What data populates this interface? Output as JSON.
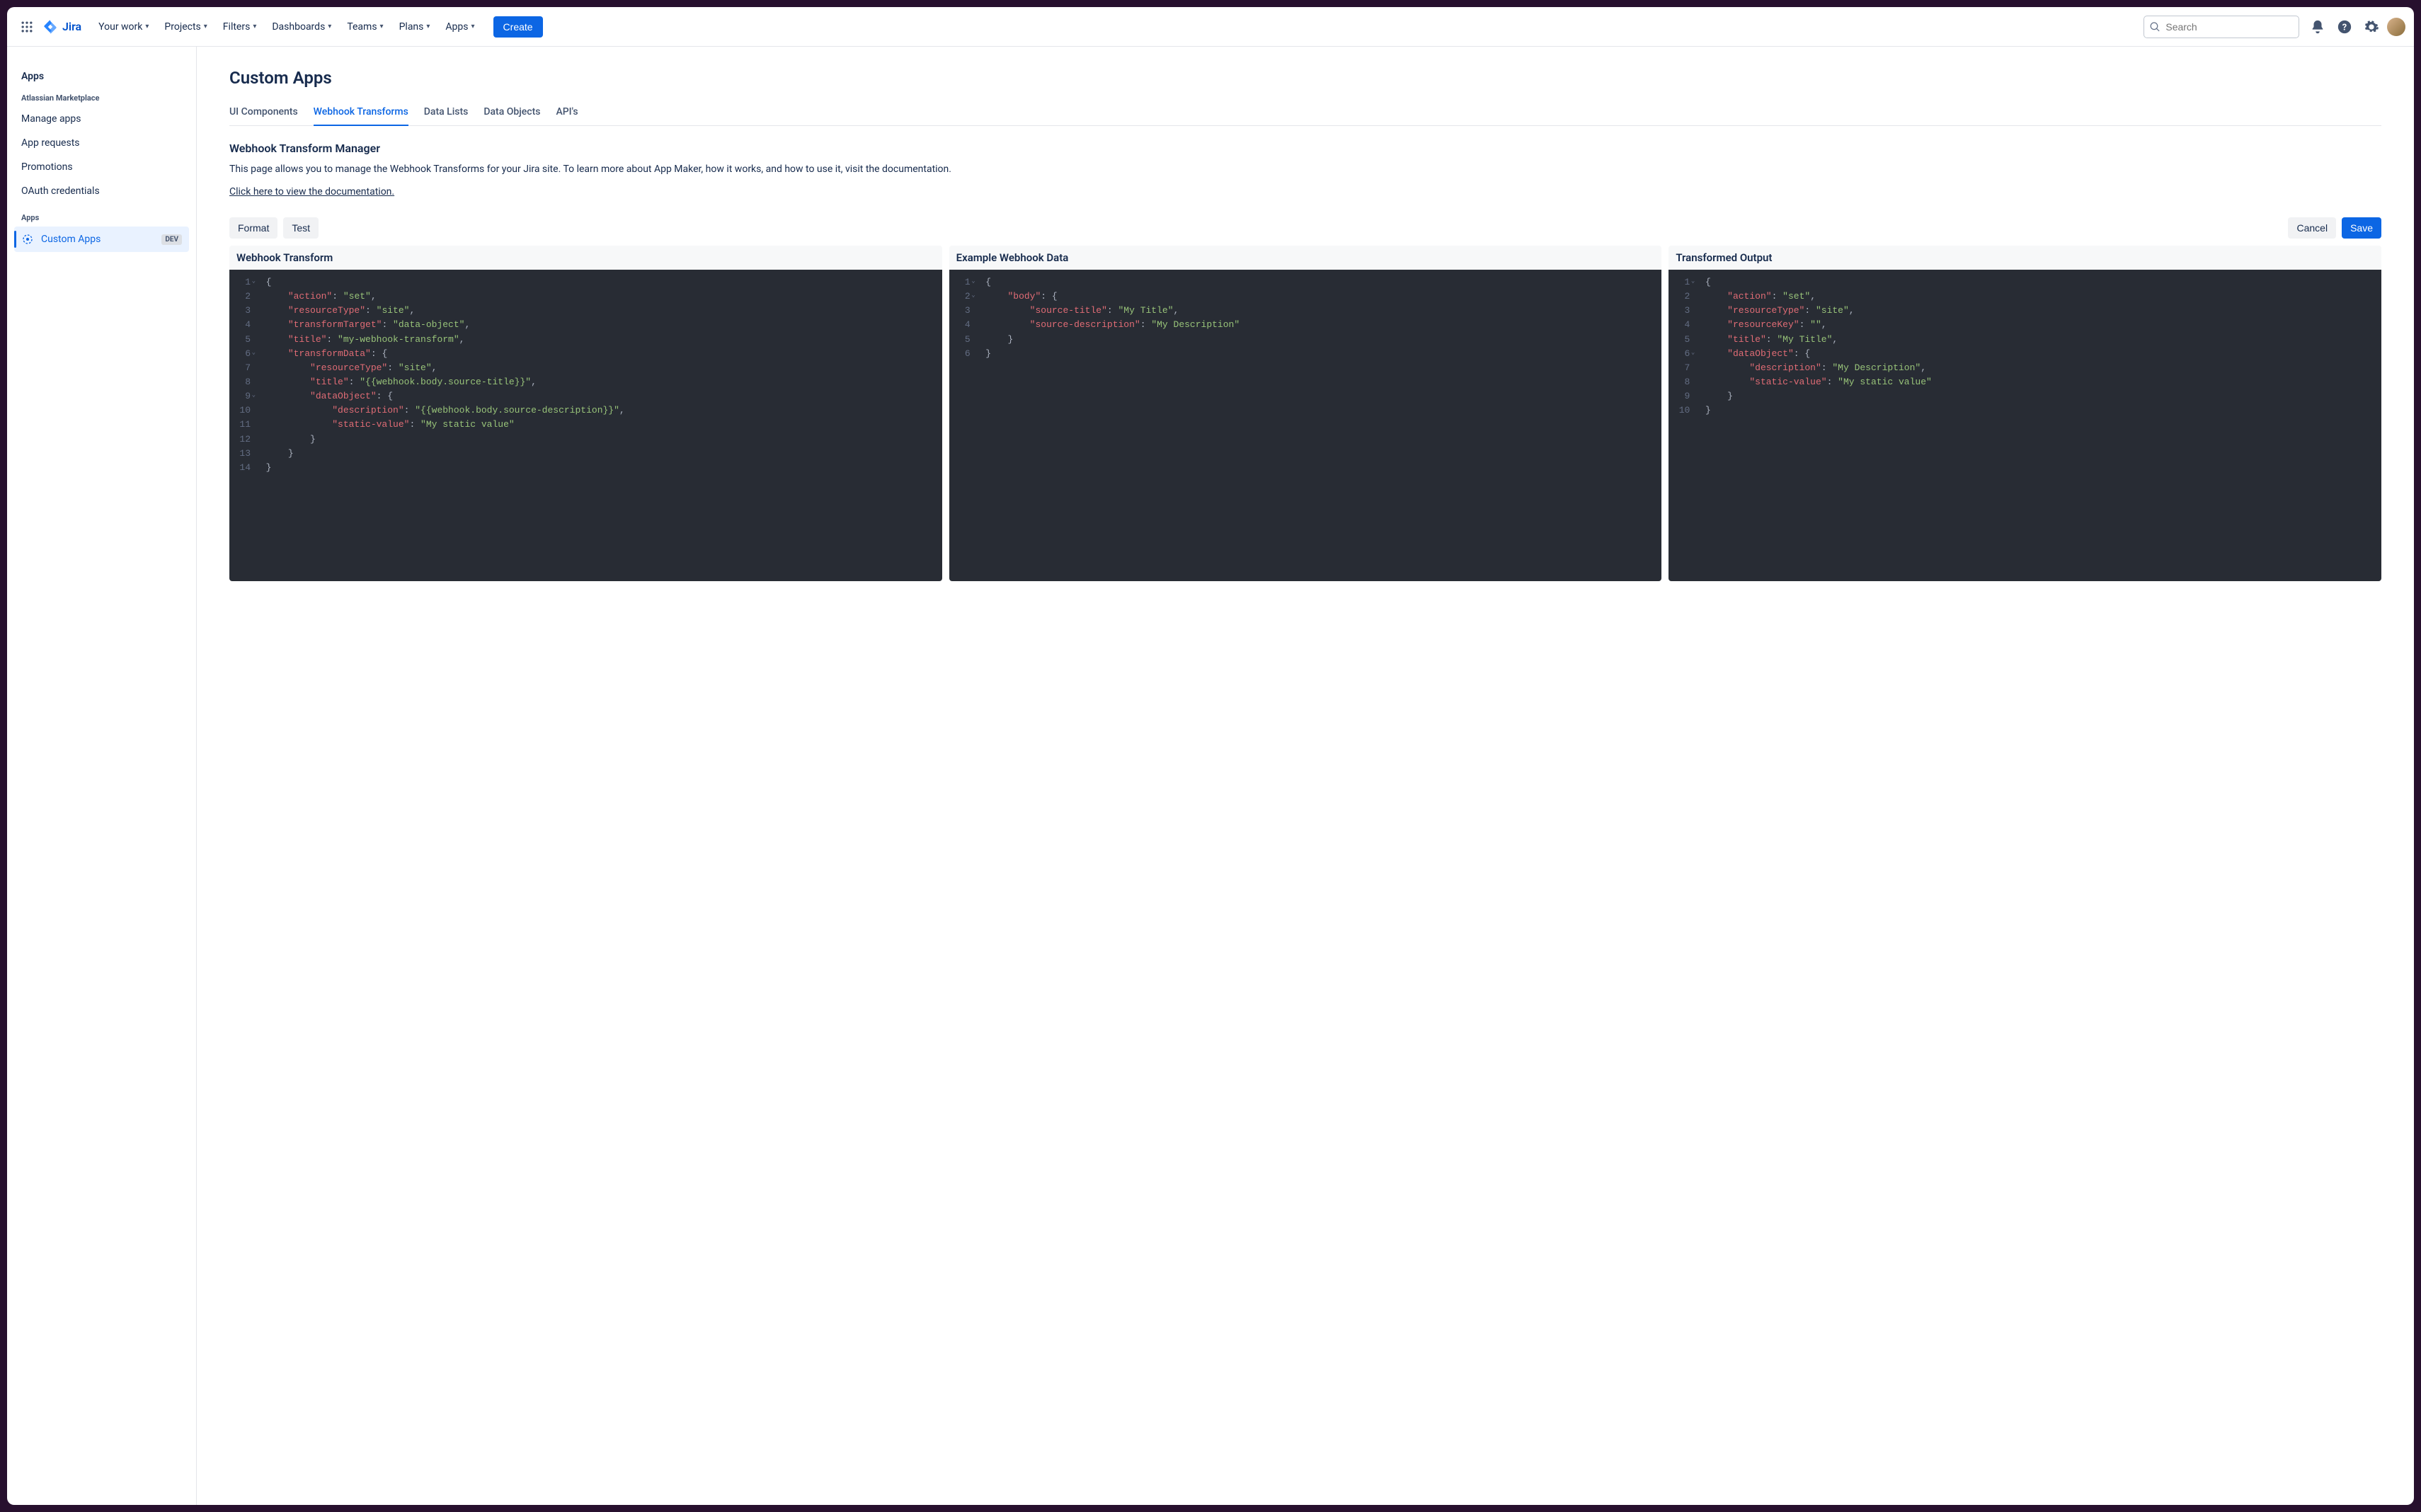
{
  "nav": {
    "product": "Jira",
    "items": [
      "Your work",
      "Projects",
      "Filters",
      "Dashboards",
      "Teams",
      "Plans",
      "Apps"
    ],
    "create": "Create",
    "search_placeholder": "Search"
  },
  "sidebar": {
    "title": "Apps",
    "section1": {
      "label": "Atlassian Marketplace",
      "items": [
        "Manage apps",
        "App requests",
        "Promotions",
        "OAuth credentials"
      ]
    },
    "section2": {
      "label": "Apps",
      "active_item": "Custom Apps",
      "badge": "DEV"
    }
  },
  "page": {
    "title": "Custom Apps",
    "tabs": [
      "UI Components",
      "Webhook Transforms",
      "Data Lists",
      "Data Objects",
      "API's"
    ],
    "active_tab_index": 1,
    "section_title": "Webhook Transform Manager",
    "description": "This page allows you to manage the Webhook Transforms for your Jira site. To learn more about App Maker, how it works, and how to use it, visit the documentation.",
    "doc_link": "Click here to view the documentation."
  },
  "toolbar": {
    "format": "Format",
    "test": "Test",
    "cancel": "Cancel",
    "save": "Save"
  },
  "editors": {
    "col1": {
      "title": "Webhook Transform",
      "lines": [
        {
          "n": 1,
          "fold": true,
          "indent": 0,
          "tokens": [
            [
              "punc",
              "{"
            ]
          ]
        },
        {
          "n": 2,
          "fold": false,
          "indent": 1,
          "tokens": [
            [
              "key",
              "\"action\""
            ],
            [
              "punc",
              ": "
            ],
            [
              "str",
              "\"set\""
            ],
            [
              "punc",
              ","
            ]
          ]
        },
        {
          "n": 3,
          "fold": false,
          "indent": 1,
          "tokens": [
            [
              "key",
              "\"resourceType\""
            ],
            [
              "punc",
              ": "
            ],
            [
              "str",
              "\"site\""
            ],
            [
              "punc",
              ","
            ]
          ]
        },
        {
          "n": 4,
          "fold": false,
          "indent": 1,
          "tokens": [
            [
              "key",
              "\"transformTarget\""
            ],
            [
              "punc",
              ": "
            ],
            [
              "str",
              "\"data-object\""
            ],
            [
              "punc",
              ","
            ]
          ]
        },
        {
          "n": 5,
          "fold": false,
          "indent": 1,
          "tokens": [
            [
              "key",
              "\"title\""
            ],
            [
              "punc",
              ": "
            ],
            [
              "str",
              "\"my-webhook-transform\""
            ],
            [
              "punc",
              ","
            ]
          ]
        },
        {
          "n": 6,
          "fold": true,
          "indent": 1,
          "tokens": [
            [
              "key",
              "\"transformData\""
            ],
            [
              "punc",
              ": {"
            ]
          ]
        },
        {
          "n": 7,
          "fold": false,
          "indent": 2,
          "tokens": [
            [
              "key",
              "\"resourceType\""
            ],
            [
              "punc",
              ": "
            ],
            [
              "str",
              "\"site\""
            ],
            [
              "punc",
              ","
            ]
          ]
        },
        {
          "n": 8,
          "fold": false,
          "indent": 2,
          "tokens": [
            [
              "key",
              "\"title\""
            ],
            [
              "punc",
              ": "
            ],
            [
              "str",
              "\"{{webhook.body.source-title}}\""
            ],
            [
              "punc",
              ","
            ]
          ]
        },
        {
          "n": 9,
          "fold": true,
          "indent": 2,
          "tokens": [
            [
              "key",
              "\"dataObject\""
            ],
            [
              "punc",
              ": {"
            ]
          ]
        },
        {
          "n": 10,
          "fold": false,
          "indent": 3,
          "tokens": [
            [
              "key",
              "\"description\""
            ],
            [
              "punc",
              ": "
            ],
            [
              "str",
              "\"{{webhook.body.source-description}}\""
            ],
            [
              "punc",
              ","
            ]
          ]
        },
        {
          "n": 11,
          "fold": false,
          "indent": 3,
          "tokens": [
            [
              "key",
              "\"static-value\""
            ],
            [
              "punc",
              ": "
            ],
            [
              "str",
              "\"My static value\""
            ]
          ]
        },
        {
          "n": 12,
          "fold": false,
          "indent": 2,
          "tokens": [
            [
              "punc",
              "}"
            ]
          ]
        },
        {
          "n": 13,
          "fold": false,
          "indent": 1,
          "tokens": [
            [
              "punc",
              "}"
            ]
          ]
        },
        {
          "n": 14,
          "fold": false,
          "indent": 0,
          "tokens": [
            [
              "punc",
              "}"
            ]
          ]
        }
      ]
    },
    "col2": {
      "title": "Example Webhook Data",
      "lines": [
        {
          "n": 1,
          "fold": true,
          "indent": 0,
          "tokens": [
            [
              "punc",
              "{"
            ]
          ]
        },
        {
          "n": 2,
          "fold": true,
          "indent": 1,
          "tokens": [
            [
              "key",
              "\"body\""
            ],
            [
              "punc",
              ": {"
            ]
          ]
        },
        {
          "n": 3,
          "fold": false,
          "indent": 2,
          "tokens": [
            [
              "key",
              "\"source-title\""
            ],
            [
              "punc",
              ": "
            ],
            [
              "str",
              "\"My Title\""
            ],
            [
              "punc",
              ","
            ]
          ]
        },
        {
          "n": 4,
          "fold": false,
          "indent": 2,
          "tokens": [
            [
              "key",
              "\"source-description\""
            ],
            [
              "punc",
              ": "
            ],
            [
              "str",
              "\"My Description\""
            ]
          ]
        },
        {
          "n": 5,
          "fold": false,
          "indent": 1,
          "tokens": [
            [
              "punc",
              "}"
            ]
          ]
        },
        {
          "n": 6,
          "fold": false,
          "indent": 0,
          "tokens": [
            [
              "punc",
              "}"
            ]
          ]
        }
      ]
    },
    "col3": {
      "title": "Transformed Output",
      "lines": [
        {
          "n": 1,
          "fold": true,
          "indent": 0,
          "tokens": [
            [
              "punc",
              "{"
            ]
          ]
        },
        {
          "n": 2,
          "fold": false,
          "indent": 1,
          "tokens": [
            [
              "key",
              "\"action\""
            ],
            [
              "punc",
              ": "
            ],
            [
              "str",
              "\"set\""
            ],
            [
              "punc",
              ","
            ]
          ]
        },
        {
          "n": 3,
          "fold": false,
          "indent": 1,
          "tokens": [
            [
              "key",
              "\"resourceType\""
            ],
            [
              "punc",
              ": "
            ],
            [
              "str",
              "\"site\""
            ],
            [
              "punc",
              ","
            ]
          ]
        },
        {
          "n": 4,
          "fold": false,
          "indent": 1,
          "tokens": [
            [
              "key",
              "\"resourceKey\""
            ],
            [
              "punc",
              ": "
            ],
            [
              "str",
              "\"\""
            ],
            [
              "punc",
              ","
            ]
          ]
        },
        {
          "n": 5,
          "fold": false,
          "indent": 1,
          "tokens": [
            [
              "key",
              "\"title\""
            ],
            [
              "punc",
              ": "
            ],
            [
              "str",
              "\"My Title\""
            ],
            [
              "punc",
              ","
            ]
          ]
        },
        {
          "n": 6,
          "fold": true,
          "indent": 1,
          "tokens": [
            [
              "key",
              "\"dataObject\""
            ],
            [
              "punc",
              ": {"
            ]
          ]
        },
        {
          "n": 7,
          "fold": false,
          "indent": 2,
          "tokens": [
            [
              "key",
              "\"description\""
            ],
            [
              "punc",
              ": "
            ],
            [
              "str",
              "\"My Description\""
            ],
            [
              "punc",
              ","
            ]
          ]
        },
        {
          "n": 8,
          "fold": false,
          "indent": 2,
          "tokens": [
            [
              "key",
              "\"static-value\""
            ],
            [
              "punc",
              ": "
            ],
            [
              "str",
              "\"My static value\""
            ]
          ]
        },
        {
          "n": 9,
          "fold": false,
          "indent": 1,
          "tokens": [
            [
              "punc",
              "}"
            ]
          ]
        },
        {
          "n": 10,
          "fold": false,
          "indent": 0,
          "tokens": [
            [
              "punc",
              "}"
            ]
          ]
        }
      ]
    }
  }
}
